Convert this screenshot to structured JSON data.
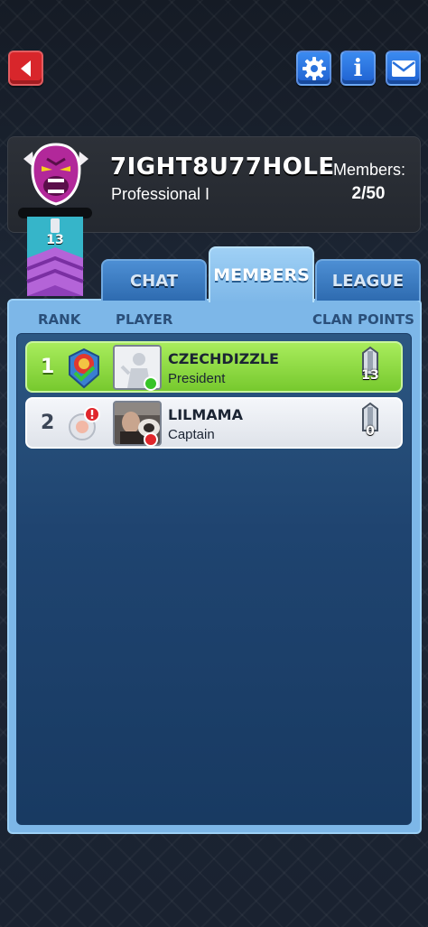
{
  "header": {
    "back_icon": "back-arrow-icon",
    "settings_icon": "gear-icon",
    "info_label": "i",
    "mail_icon": "mail-icon"
  },
  "clan": {
    "name": "7IGHT8U77HOLE",
    "league": "Professional I",
    "members_label": "Members:",
    "members_count": "2/50",
    "rank_number": "13",
    "emblem": "gorilla-emblem-icon"
  },
  "tabs": [
    {
      "label": "CHAT",
      "active": false
    },
    {
      "label": "MEMBERS",
      "active": true
    },
    {
      "label": "LEAGUE",
      "active": false
    }
  ],
  "columns": {
    "rank": "RANK",
    "player": "PLAYER",
    "points": "CLAN POINTS"
  },
  "members": [
    {
      "rank": "1",
      "name": "CZECHDIZZLE",
      "role": "President",
      "points": "13",
      "status": "online",
      "status_color": "#36c427"
    },
    {
      "rank": "2",
      "name": "LILMAMA",
      "role": "Captain",
      "points": "0",
      "status": "offline",
      "status_color": "#e0262b"
    }
  ],
  "colors": {
    "accent_blue": "#2e6bb0",
    "active_tab": "#7db7e8",
    "leader_row": "#77c92e",
    "back_red": "#d8262b"
  }
}
